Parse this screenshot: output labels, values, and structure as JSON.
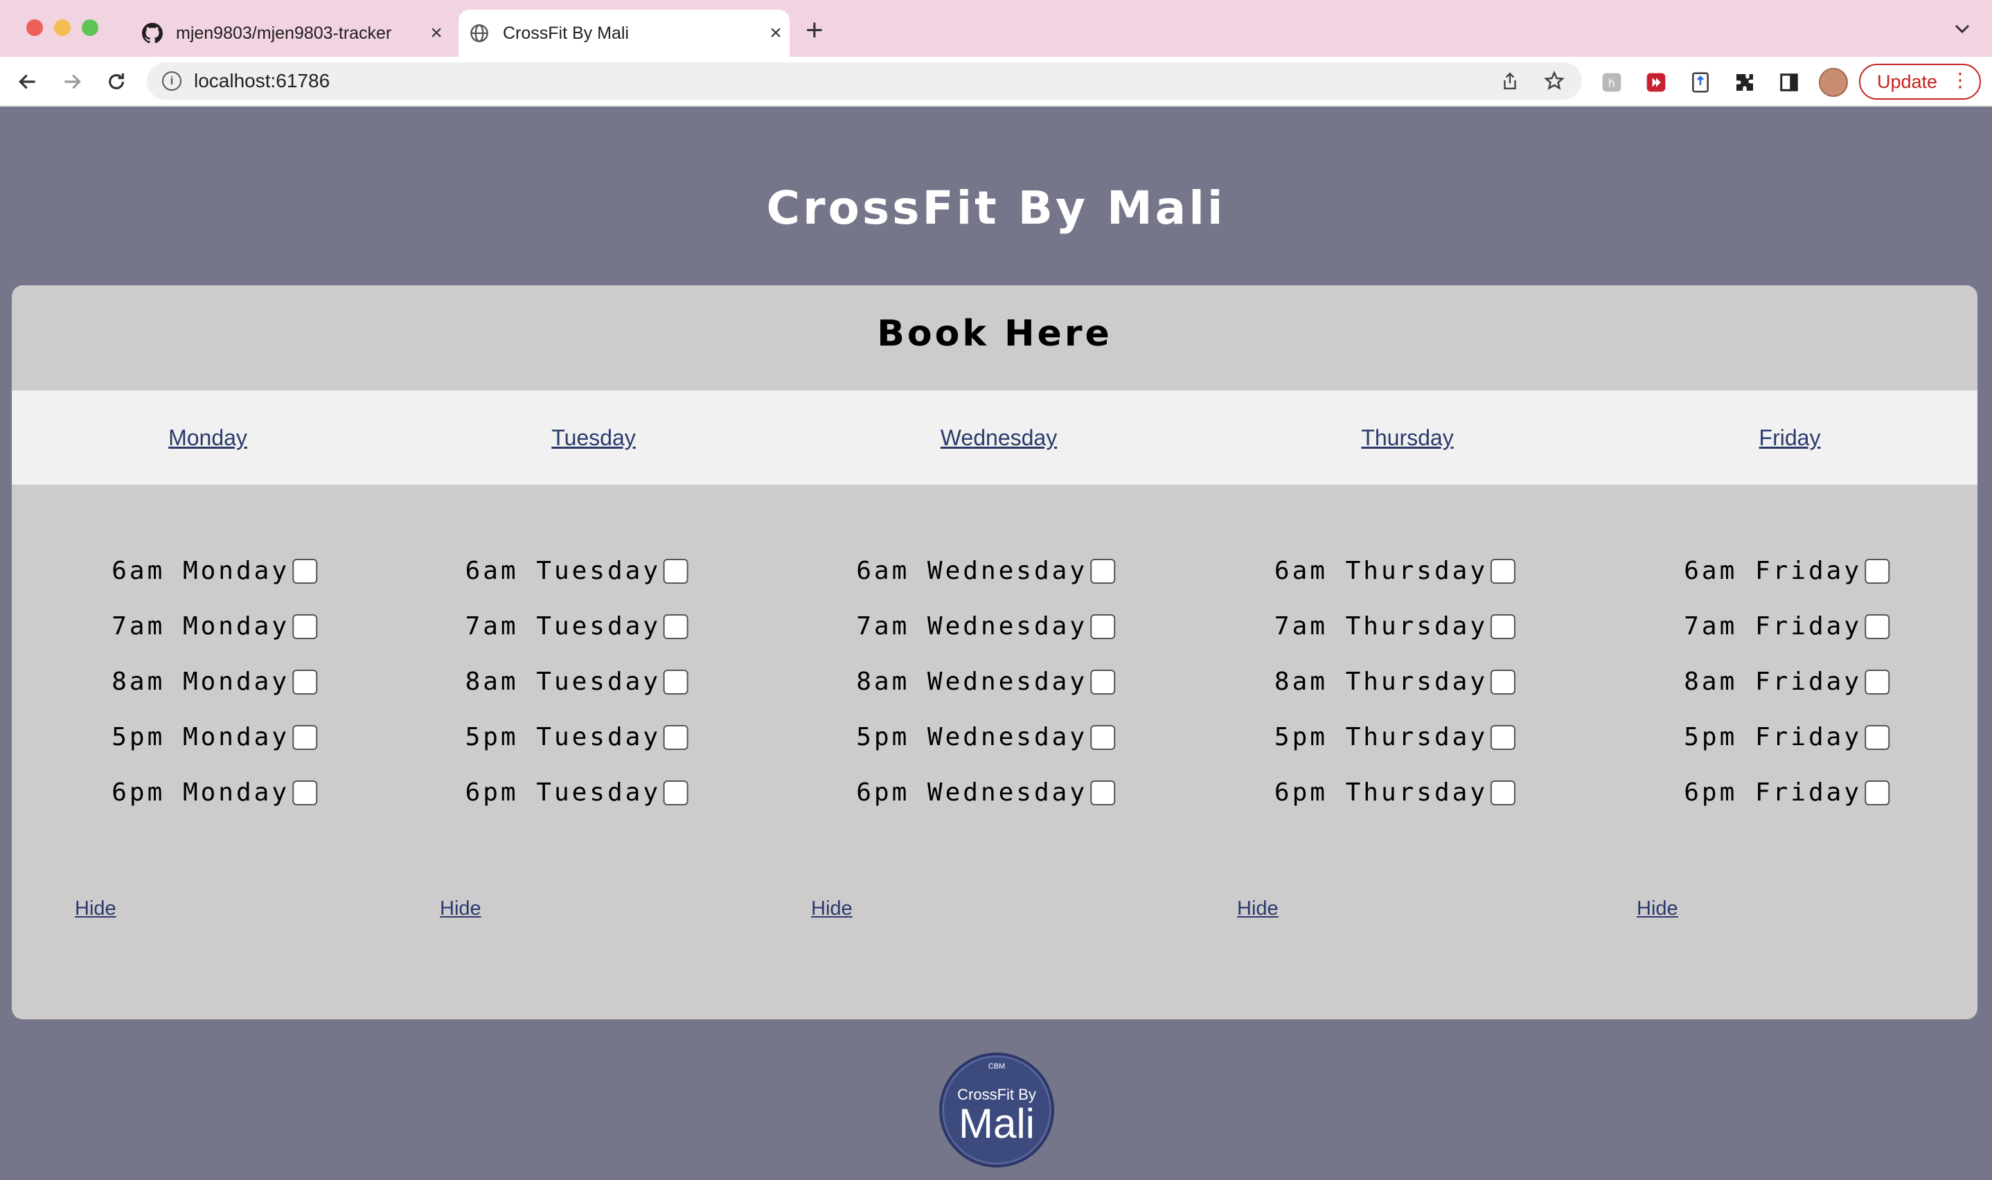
{
  "browser": {
    "tabs": [
      {
        "title": "mjen9803/mjen9803-tracker",
        "icon": "github-icon"
      },
      {
        "title": "CrossFit By Mali",
        "icon": "globe-icon"
      }
    ],
    "url": "localhost:61786",
    "update_label": "Update"
  },
  "page": {
    "title": "CrossFit By Mali",
    "card_title": "Book Here",
    "logo": {
      "small": "CBM",
      "line1": "CrossFit By",
      "line2": "Mali"
    }
  },
  "days": [
    {
      "name": "Monday",
      "hide_label": "Hide",
      "slots": [
        "6am Monday",
        "7am Monday",
        "8am Monday",
        "5pm Monday",
        "6pm Monday"
      ]
    },
    {
      "name": "Tuesday",
      "hide_label": "Hide",
      "slots": [
        "6am Tuesday",
        "7am Tuesday",
        "8am Tuesday",
        "5pm Tuesday",
        "6pm Tuesday"
      ]
    },
    {
      "name": "Wednesday",
      "hide_label": "Hide",
      "slots": [
        "6am Wednesday",
        "7am Wednesday",
        "8am Wednesday",
        "5pm Wednesday",
        "6pm Wednesday"
      ]
    },
    {
      "name": "Thursday",
      "hide_label": "Hide",
      "slots": [
        "6am Thursday",
        "7am Thursday",
        "8am Thursday",
        "5pm Thursday",
        "6pm Thursday"
      ]
    },
    {
      "name": "Friday",
      "hide_label": "Hide",
      "slots": [
        "6am Friday",
        "7am Friday",
        "8am Friday",
        "5pm Friday",
        "6pm Friday"
      ]
    }
  ],
  "colors": {
    "page_background": "#757689",
    "card_background": "#cdcbcc",
    "nav_background": "#f1f1f1",
    "link": "#2b3a6b",
    "tabbar": "#f2d3e1",
    "update_accent": "#c5221f",
    "logo": "#3d4a7e"
  }
}
